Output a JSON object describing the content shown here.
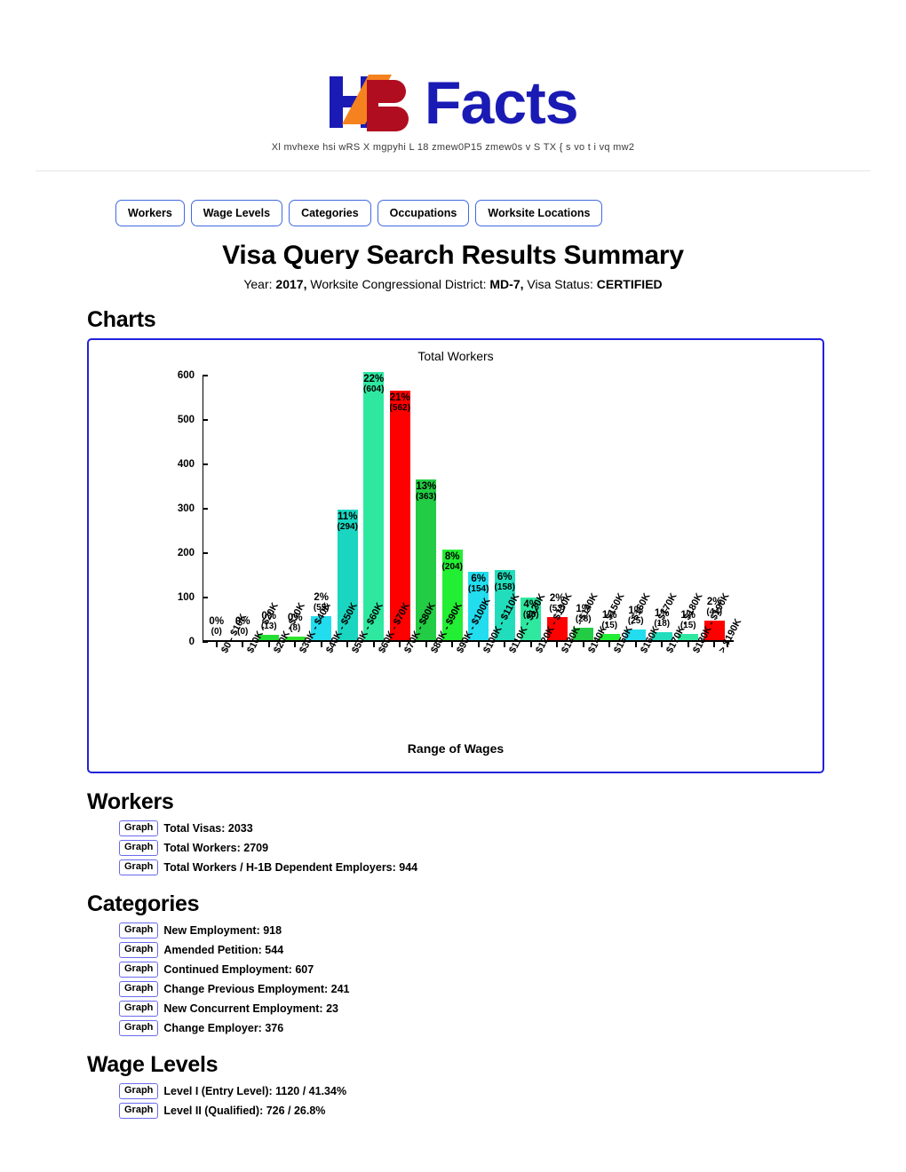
{
  "brand": {
    "mark_h": "H",
    "mark_b": "B",
    "word": "Facts"
  },
  "tagline": "Xl mvhexe hsi wRS X mgpyhi  L 18 zmew0P15 zmew0s v S TX { s vo t i vq mw2",
  "nav": [
    {
      "label": "Workers"
    },
    {
      "label": "Wage Levels"
    },
    {
      "label": "Categories"
    },
    {
      "label": "Occupations"
    },
    {
      "label": "Worksite Locations"
    }
  ],
  "page_title": "Visa Query Search Results Summary",
  "subtitle": {
    "year_label": "Year:",
    "year_value": "2017,",
    "district_label": "Worksite Congressional District:",
    "district_value": "MD-7,",
    "status_label": "Visa Status:",
    "status_value": "CERTIFIED"
  },
  "sections": {
    "charts": "Charts",
    "workers": "Workers",
    "categories": "Categories",
    "wage_levels": "Wage Levels"
  },
  "graph_button_label": "Graph",
  "workers_items": [
    "Total Visas: 2033",
    "Total Workers: 2709",
    "Total Workers / H-1B Dependent Employers: 944"
  ],
  "categories_items": [
    "New Employment: 918",
    "Amended Petition: 544",
    "Continued Employment: 607",
    "Change Previous Employment: 241",
    "New Concurrent Employment: 23",
    "Change Employer: 376"
  ],
  "wage_level_items": [
    "Level I (Entry Level): 1120 / 41.34%",
    "Level II (Qualified): 726 / 26.8%"
  ],
  "chart_data": {
    "type": "bar",
    "title": "Total Workers",
    "xlabel": "Range of Wages",
    "ylabel": "",
    "ylim": [
      0,
      600
    ],
    "yticks": [
      0,
      100,
      200,
      300,
      400,
      500,
      600
    ],
    "grid": false,
    "legend": "none",
    "categories": [
      "$0 - $10K",
      "$10K - $20K",
      "$20K - $30K",
      "$30K - $40K",
      "$40K - $50K",
      "$50K - $60K",
      "$60K - $70K",
      "$70K - $80K",
      "$80K - $90K",
      "$90K - $100K",
      "$100K - $110K",
      "$110K - $120K",
      "$120K - $130K",
      "$130K - $140K",
      "$140K - $150K",
      "$150K - $160K",
      "$160K - $170K",
      "$170K - $180K",
      "$180K - $190K",
      "> $190K"
    ],
    "values": [
      0,
      0,
      13,
      8,
      55,
      294,
      604,
      562,
      363,
      204,
      154,
      158,
      96,
      53,
      28,
      15,
      25,
      18,
      15,
      44
    ],
    "percent_labels": [
      "0%",
      "0%",
      "0%",
      "0%",
      "2%",
      "11%",
      "22%",
      "21%",
      "13%",
      "8%",
      "6%",
      "6%",
      "4%",
      "2%",
      "1%",
      "1%",
      "1%",
      "1%",
      "1%",
      "2%"
    ],
    "count_labels": [
      "(0)",
      "(0)",
      "(13)",
      "(8)",
      "(55)",
      "(294)",
      "(604)",
      "(562)",
      "(363)",
      "(204)",
      "(154)",
      "(158)",
      "(96)",
      "(53)",
      "(28)",
      "(15)",
      "(25)",
      "(18)",
      "(15)",
      "(44)"
    ],
    "colors": [
      "#00cc44",
      "#00ee33",
      "#22dd33",
      "#2ee22e",
      "#22ddee",
      "#1ad6c0",
      "#2ee8a0",
      "#ff0000",
      "#22cc44",
      "#22ee33",
      "#22ddee",
      "#22ddbb",
      "#2ee8a0",
      "#ff0000",
      "#22cc44",
      "#22ee33",
      "#22ddee",
      "#22ddbb",
      "#2ee8a0",
      "#ff0000"
    ],
    "label_inside_flags": [
      false,
      false,
      false,
      false,
      false,
      true,
      true,
      true,
      true,
      true,
      true,
      true,
      true,
      false,
      false,
      false,
      false,
      false,
      false,
      false
    ]
  },
  "colors": {
    "accent_blue": "#1a1ab5",
    "nav_border": "#4169e1",
    "panel_border": "#2222dd",
    "logo_orange": "#f5821f",
    "logo_red": "#b10d20"
  }
}
